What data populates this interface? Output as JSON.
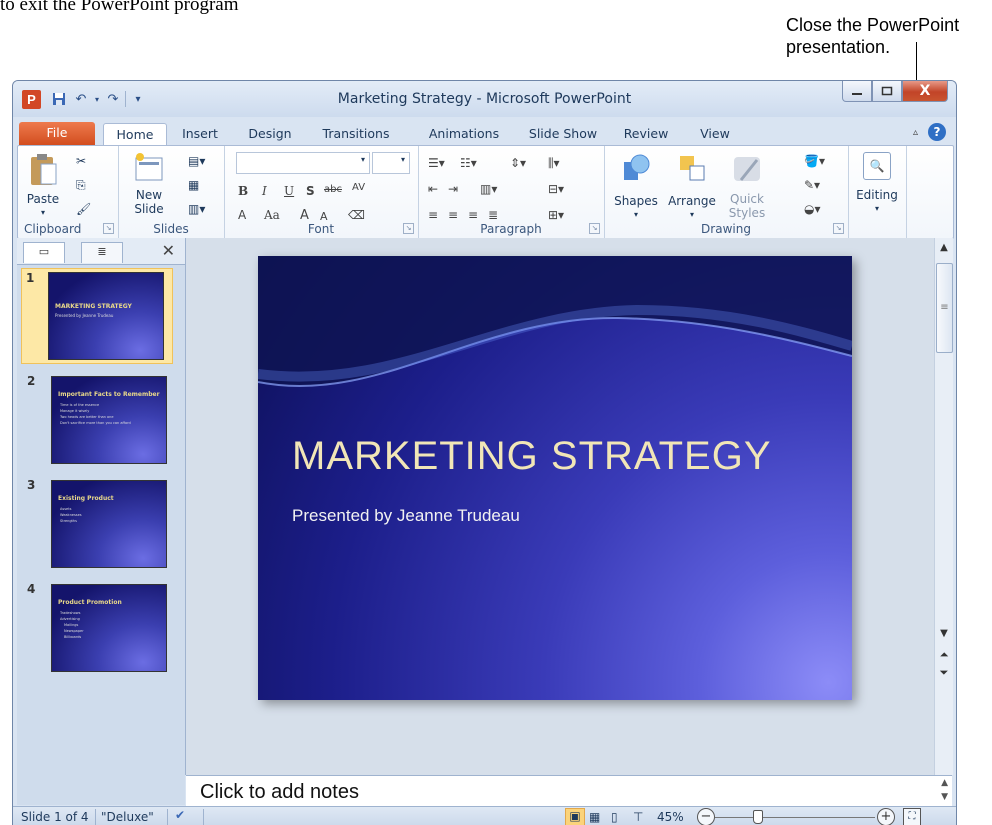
{
  "doc": {
    "top_text": "to exit the PowerPoint program",
    "callout_line1": "Close the PowerPoint",
    "callout_line2": "presentation."
  },
  "window": {
    "title": "Marketing Strategy - Microsoft PowerPoint",
    "app_icon_letter": "P",
    "close_glyph": "X",
    "accent_color": "#d24726"
  },
  "tabs": [
    "File",
    "Home",
    "Insert",
    "Design",
    "Transitions",
    "Animations",
    "Slide Show",
    "Review",
    "View"
  ],
  "ribbon": {
    "clipboard": {
      "paste": "Paste",
      "label": "Clipboard"
    },
    "slides": {
      "new_slide_1": "New",
      "new_slide_2": "Slide",
      "label": "Slides"
    },
    "font": {
      "label": "Font",
      "bold": "B",
      "italic": "I",
      "underline": "U",
      "shadow": "S",
      "strike": "abc",
      "spacing": "AV",
      "color": "A",
      "case": "Aa",
      "grow": "A",
      "shrink": "A"
    },
    "paragraph": {
      "label": "Paragraph"
    },
    "drawing": {
      "shapes": "Shapes",
      "arrange": "Arrange",
      "quick_styles_1": "Quick",
      "quick_styles_2": "Styles",
      "label": "Drawing"
    },
    "editing": {
      "label": "Editing"
    }
  },
  "slides_pane": {
    "thumbnails": [
      {
        "num": "1",
        "title": "MARKETING STRATEGY",
        "sub": "Presented by Jeanne Trudeau",
        "bullets": []
      },
      {
        "num": "2",
        "title": "Important Facts to Remember",
        "sub": "",
        "bullets": [
          "Time is of the essence",
          "Manage it wisely",
          "Two heads are better than one",
          "Don't sacrifice more than you can afford"
        ]
      },
      {
        "num": "3",
        "title": "Existing Product",
        "sub": "",
        "bullets": [
          "Assets",
          "Weaknesses",
          "Strengths"
        ]
      },
      {
        "num": "4",
        "title": "Product Promotion",
        "sub": "",
        "bullets": [
          "Tradeshows",
          "Advertising",
          "Mailings",
          "Newspaper",
          "Billboards"
        ]
      }
    ]
  },
  "slide": {
    "title": "MARKETING STRATEGY",
    "subtitle": "Presented by Jeanne Trudeau"
  },
  "notes": {
    "placeholder": "Click to add notes"
  },
  "status": {
    "slide_counter": "Slide 1 of 4",
    "theme": "\"Deluxe\"",
    "zoom": "45%"
  }
}
